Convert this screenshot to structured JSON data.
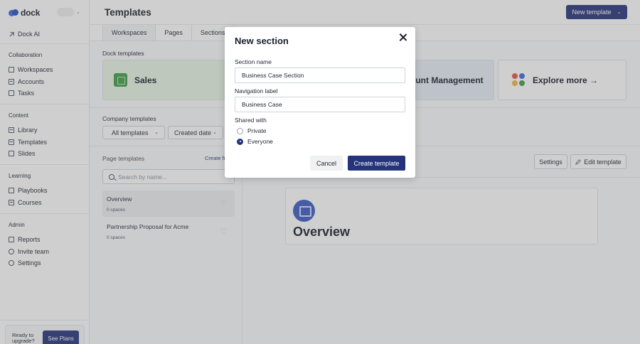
{
  "sidebar": {
    "logo_text": "dock",
    "ai_label": "Dock AI",
    "sections": [
      {
        "heading": "Collaboration",
        "items": [
          "Workspaces",
          "Accounts",
          "Tasks"
        ]
      },
      {
        "heading": "Content",
        "items": [
          "Library",
          "Templates",
          "Slides"
        ]
      },
      {
        "heading": "Learning",
        "items": [
          "Playbooks",
          "Courses"
        ]
      },
      {
        "heading": "Admin",
        "items": [
          "Reports",
          "Invite team",
          "Settings"
        ]
      }
    ],
    "upgrade_text": "Ready to upgrade?",
    "see_plans": "See Plans"
  },
  "header": {
    "title": "Templates",
    "new_template": "New template"
  },
  "tabs": [
    "Workspaces",
    "Pages",
    "Sections"
  ],
  "dock_templates": {
    "label": "Dock templates",
    "cards": [
      "Sales",
      "ount Management",
      "Explore more →"
    ]
  },
  "company_templates": {
    "label": "Company templates",
    "filter_all": "All templates",
    "filter_date": "Created date"
  },
  "page_templates": {
    "label": "Page templates",
    "create_link": "Create fr",
    "search_placeholder": "Search by name...",
    "items": [
      {
        "title": "Overview",
        "subtitle": "0 spaces"
      },
      {
        "title": "Partnership Proposal for Acme",
        "subtitle": "0 spaces"
      }
    ]
  },
  "preview": {
    "settings": "Settings",
    "edit_template": "Edit template",
    "title": "Overview"
  },
  "modal": {
    "title": "New section",
    "section_name_label": "Section name",
    "section_name_value": "Business Case Section",
    "nav_label": "Navigation label",
    "nav_value": "Business Case",
    "shared_with_label": "Shared with",
    "option_private": "Private",
    "option_everyone": "Everyone",
    "selected_option": "Everyone",
    "cancel": "Cancel",
    "create": "Create template"
  },
  "colors": {
    "primary": "#24337a",
    "overlay": "#5f5f5f"
  }
}
